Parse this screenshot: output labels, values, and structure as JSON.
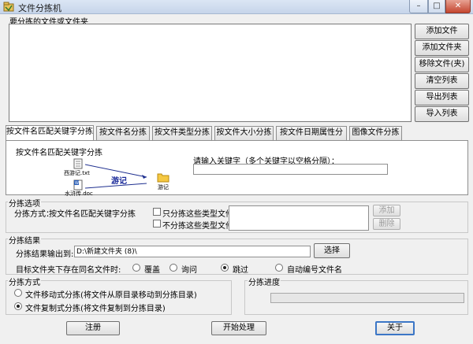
{
  "window": {
    "title": "文件分拣机",
    "controls": {
      "minimize": "–",
      "maximize": "□",
      "close": "✕"
    }
  },
  "files_group": {
    "label": "要分拣的文件或文件夹"
  },
  "side_buttons": [
    "添加文件",
    "添加文件夹",
    "移除文件(夹)",
    "清空列表",
    "导出列表",
    "导入列表"
  ],
  "tabs": [
    {
      "label": "按文件名匹配关键字分拣",
      "active": true
    },
    {
      "label": "按文件名分拣",
      "active": false
    },
    {
      "label": "按文件类型分拣",
      "active": false
    },
    {
      "label": "按文件大小分拣",
      "active": false
    },
    {
      "label": "按文件日期属性分拣",
      "active": false
    },
    {
      "label": "图像文件分拣",
      "active": false
    }
  ],
  "panel": {
    "title": "按文件名匹配关键字分拣",
    "illustration": {
      "file1": "西游记.txt",
      "file2": "水浒传.doc",
      "keyword": "游记",
      "folder": "游记"
    },
    "keyword_label": "请输入关键字（多个关键字以空格分隔）：",
    "keyword_value": ""
  },
  "options": {
    "group_label": "分拣选项",
    "method_label": "分拣方式：",
    "method_value": "按文件名匹配关键字分拣",
    "only_types_label": "只分拣这些类型文件:",
    "exclude_types_label": "不分拣这些类型文件:",
    "only_types_checked": false,
    "exclude_types_checked": false,
    "add_button": "添加",
    "delete_button": "删除"
  },
  "result": {
    "group_label": "分拣结果",
    "output_label": "分拣结果输出到:",
    "output_value": "D:\\新建文件夹 (8)\\",
    "select_button": "选择",
    "conflict_label": "目标文件夹下存在同名文件时:",
    "conflict_options": [
      {
        "label": "覆盖",
        "selected": false
      },
      {
        "label": "询问",
        "selected": false
      },
      {
        "label": "跳过",
        "selected": true
      },
      {
        "label": "自动编号文件名",
        "selected": false
      }
    ]
  },
  "mode": {
    "group_label": "分拣方式",
    "options": [
      {
        "label": "文件移动式分拣(将文件从原目录移动到分拣目录)",
        "selected": false
      },
      {
        "label": "文件复制式分拣(将文件复制到分拣目录)",
        "selected": true
      }
    ]
  },
  "progress": {
    "group_label": "分拣进度",
    "value": 0
  },
  "bottom_buttons": {
    "register": "注册",
    "start": "开始处理",
    "about": "关于"
  }
}
